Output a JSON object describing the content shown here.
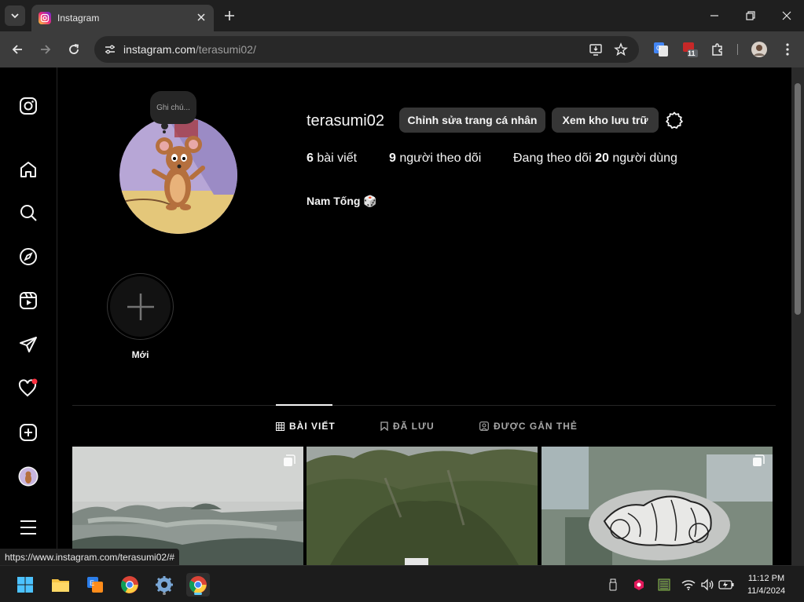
{
  "browser": {
    "tab_title": "Instagram",
    "url_host": "instagram.com",
    "url_path": "/terasumi02/",
    "extension_badge": "11",
    "status_url": "https://www.instagram.com/terasumi02/#"
  },
  "profile": {
    "note": "Ghi chú...",
    "username": "terasumi02",
    "edit_button": "Chỉnh sửa trang cá nhân",
    "archive_button": "Xem kho lưu trữ",
    "posts_count": "6",
    "posts_label": "bài viết",
    "followers_count": "9",
    "followers_label": "người theo dõi",
    "following_prefix": "Đang theo dõi",
    "following_count": "20",
    "following_suffix": "người dùng",
    "full_name": "Nam Tống 🎲",
    "new_highlight_label": "Mới"
  },
  "profile_tabs": [
    {
      "label": "BÀI VIẾT",
      "active": true
    },
    {
      "label": "ĐÃ LƯU",
      "active": false
    },
    {
      "label": "ĐƯỢC GẮN THẺ",
      "active": false
    }
  ],
  "nav_icons": [
    "instagram-logo-icon",
    "home-icon",
    "search-icon",
    "explore-icon",
    "reels-icon",
    "messages-icon",
    "notifications-icon",
    "create-icon",
    "profile-avatar",
    "more-menu-icon"
  ],
  "notification_dot_color": "#ff3040",
  "taskbar": {
    "time": "11:12 PM",
    "date": "11/4/2024"
  }
}
